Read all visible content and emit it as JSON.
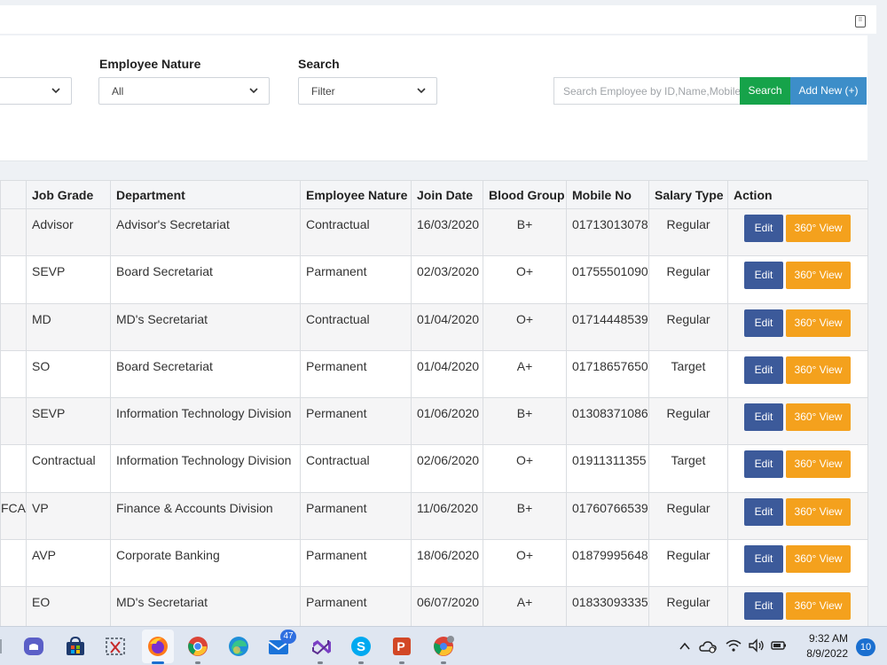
{
  "filters": {
    "employee_nature_label": "Employee Nature",
    "employee_nature_value": "All",
    "search_label": "Search",
    "search_select_value": "Filter",
    "search_placeholder": "Search Employee by ID,Name,Mobile",
    "search_button": "Search",
    "add_new_button": "Add New (+)"
  },
  "table": {
    "headers": [
      "Job Grade",
      "Department",
      "Employee Nature",
      "Join Date",
      "Blood Group",
      "Mobile No",
      "Salary Type",
      "Action"
    ],
    "edit_label": "Edit",
    "view_label": "360° View",
    "rows": [
      {
        "prev": "",
        "grade": "Advisor",
        "dept": "Advisor's Secretariat",
        "nature": "Contractual",
        "join": "16/03/2020",
        "blood": "B+",
        "mobile": "01713013078",
        "salary": "Regular"
      },
      {
        "prev": "",
        "grade": "SEVP",
        "dept": "Board Secretariat",
        "nature": "Parmanent",
        "join": "02/03/2020",
        "blood": "O+",
        "mobile": "01755501090",
        "salary": "Regular"
      },
      {
        "prev": "",
        "grade": "MD",
        "dept": "MD's Secretariat",
        "nature": "Contractual",
        "join": "01/04/2020",
        "blood": "O+",
        "mobile": "01714448539",
        "salary": "Regular"
      },
      {
        "prev": "",
        "grade": "SO",
        "dept": "Board Secretariat",
        "nature": "Permanent",
        "join": "01/04/2020",
        "blood": "A+",
        "mobile": "01718657650",
        "salary": "Target"
      },
      {
        "prev": "",
        "grade": "SEVP",
        "dept": "Information Technology Division",
        "nature": "Permanent",
        "join": "01/06/2020",
        "blood": "B+",
        "mobile": "01308371086",
        "salary": "Regular"
      },
      {
        "prev": "",
        "grade": "Contractual",
        "dept": "Information Technology Division",
        "nature": "Contractual",
        "join": "02/06/2020",
        "blood": "O+",
        "mobile": "01911311355",
        "salary": "Target"
      },
      {
        "prev": "FCA",
        "grade": "VP",
        "dept": "Finance & Accounts Division",
        "nature": "Parmanent",
        "join": "11/06/2020",
        "blood": "B+",
        "mobile": "01760766539",
        "salary": "Regular"
      },
      {
        "prev": "",
        "grade": "AVP",
        "dept": "Corporate Banking",
        "nature": "Parmanent",
        "join": "18/06/2020",
        "blood": "O+",
        "mobile": "01879995648",
        "salary": "Regular"
      },
      {
        "prev": "",
        "grade": "EO",
        "dept": "MD's Secretariat",
        "nature": "Parmanent",
        "join": "06/07/2020",
        "blood": "A+",
        "mobile": "01833093335",
        "salary": "Regular"
      }
    ]
  },
  "taskbar": {
    "apps": [
      "teams-icon",
      "store-icon",
      "snipping-tool-icon",
      "firefox-icon",
      "chrome-icon",
      "edge-icon",
      "mail-icon",
      "visual-studio-icon",
      "skype-icon",
      "powerpoint-icon",
      "chrome-profile-icon"
    ],
    "mail_badge": "47",
    "time": "9:32 AM",
    "date": "8/9/2022",
    "notifications": "10",
    "accent": "#1a6fd0"
  }
}
